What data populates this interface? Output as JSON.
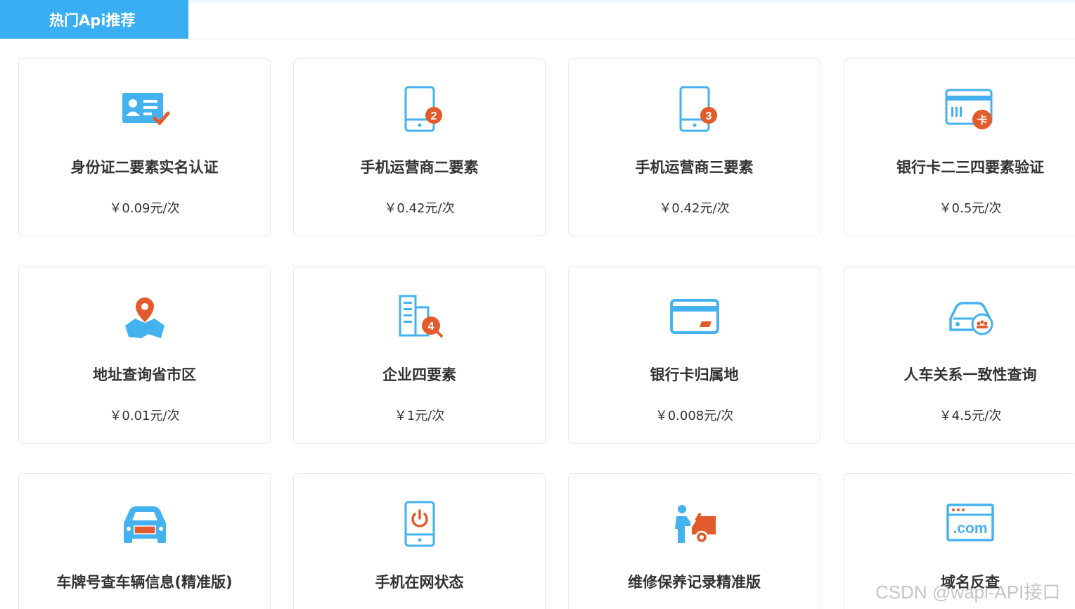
{
  "header": {
    "tab_label": "热门Api推荐"
  },
  "colors": {
    "accent": "#3aaef2",
    "icon_blue": "#45b2f0",
    "icon_orange": "#e35b2c",
    "text": "#333333"
  },
  "cards": [
    {
      "title": "身份证二要素实名认证",
      "price": "￥0.09元/次",
      "icon": "id-card-check-icon"
    },
    {
      "title": "手机运营商二要素",
      "price": "￥0.42元/次",
      "icon": "phone-2-icon",
      "badge": "2"
    },
    {
      "title": "手机运营商三要素",
      "price": "￥0.42元/次",
      "icon": "phone-3-icon",
      "badge": "3"
    },
    {
      "title": "银行卡二三四要素验证",
      "price": "￥0.5元/次",
      "icon": "bank-card-badge-icon",
      "badge": "卡"
    },
    {
      "title": "地址查询省市区",
      "price": "￥0.01元/次",
      "icon": "map-pin-icon"
    },
    {
      "title": "企业四要素",
      "price": "￥1元/次",
      "icon": "building-4-icon",
      "badge": "4"
    },
    {
      "title": "银行卡归属地",
      "price": "￥0.008元/次",
      "icon": "credit-card-icon"
    },
    {
      "title": "人车关系一致性查询",
      "price": "￥4.5元/次",
      "icon": "car-people-icon"
    },
    {
      "title": "车牌号查车辆信息(精准版)",
      "price": "",
      "icon": "car-plate-icon"
    },
    {
      "title": "手机在网状态",
      "price": "",
      "icon": "phone-power-icon"
    },
    {
      "title": "维修保养记录精准版",
      "price": "",
      "icon": "car-repair-icon"
    },
    {
      "title": "域名反查",
      "price": "",
      "icon": "domain-com-icon",
      "badge": ".com"
    }
  ],
  "watermark": "CSDN @wapi-API接口"
}
